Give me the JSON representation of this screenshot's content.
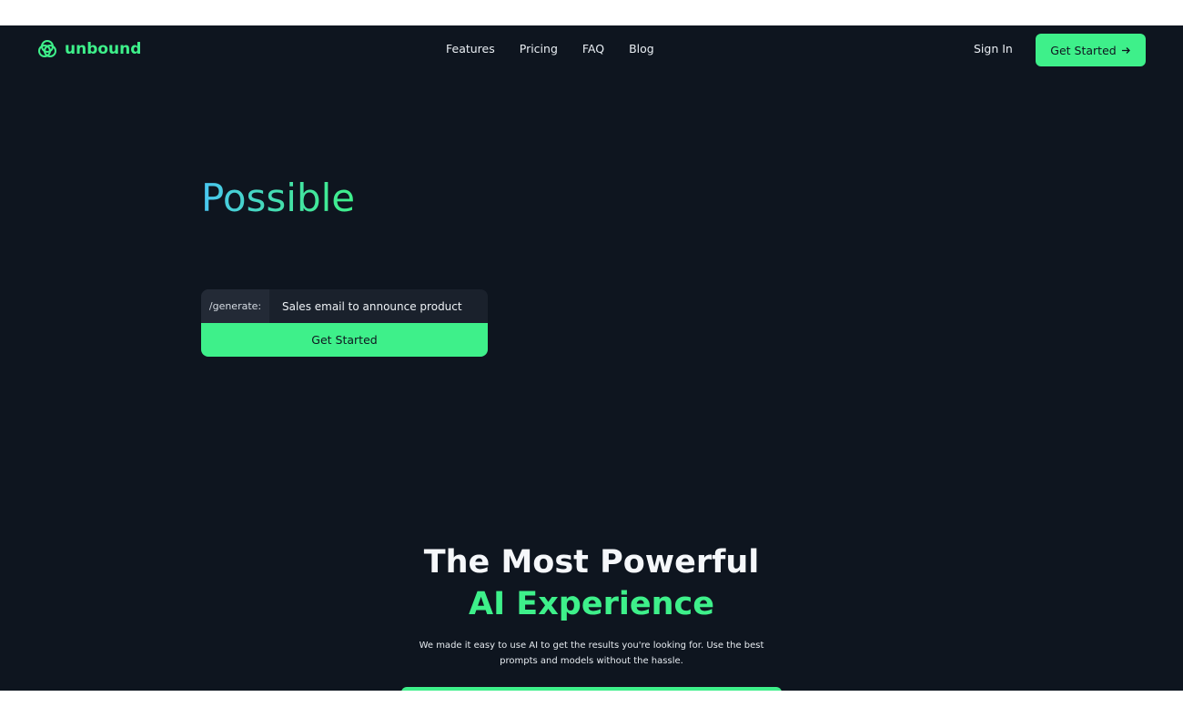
{
  "header": {
    "brand": "unbound",
    "nav": [
      "Features",
      "Pricing",
      "FAQ",
      "Blog"
    ],
    "sign_in": "Sign In",
    "cta": "Get Started",
    "cta_icon": "arrow-right-icon"
  },
  "hero": {
    "word": "Possible",
    "generator": {
      "prefix": "/generate:",
      "value": "Sales email to announce product",
      "button": "Get Started"
    }
  },
  "section": {
    "title_line1": "The Most Powerful",
    "title_line2": "AI Experience",
    "description": "We made it easy to use AI to get the results you're looking for. Use the best prompts and models without the hassle."
  },
  "colors": {
    "background": "#0e151f",
    "accent": "#3ef08a",
    "gradient_start": "#49c6f2"
  }
}
